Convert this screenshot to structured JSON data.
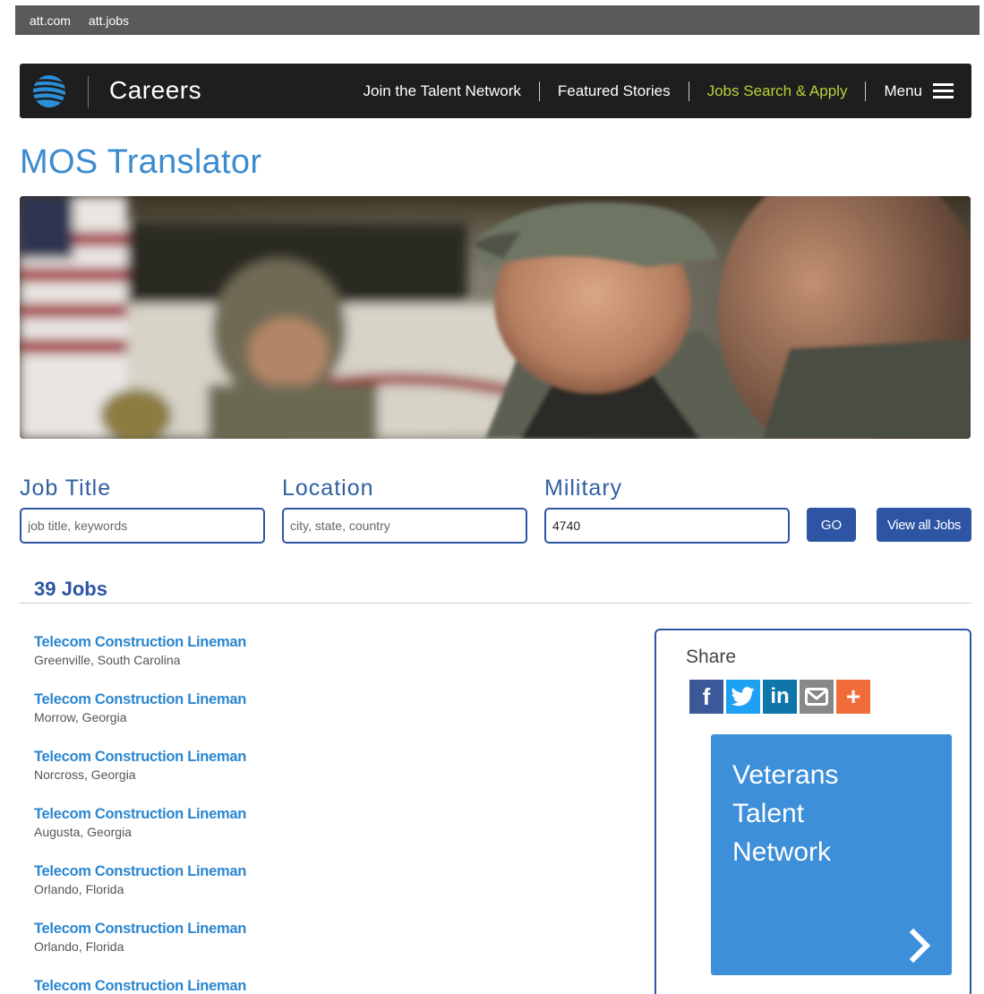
{
  "utility_links": [
    "att.com",
    "att.jobs"
  ],
  "nav": {
    "brand": "Careers",
    "links": [
      "Join the Talent Network",
      "Featured Stories",
      "Jobs Search & Apply"
    ],
    "menu_label": "Menu"
  },
  "page_title": "MOS Translator",
  "search": {
    "job_title_label": "Job Title",
    "job_title_placeholder": "job title, keywords",
    "job_title_value": "",
    "location_label": "Location",
    "location_placeholder": "city, state, country",
    "location_value": "",
    "military_label": "Military",
    "military_value": "4740",
    "go_label": "GO",
    "view_all_label": "View all Jobs"
  },
  "results": {
    "count_text": "39 Jobs",
    "jobs": [
      {
        "title": "Telecom Construction Lineman",
        "location": "Greenville, South Carolina"
      },
      {
        "title": "Telecom Construction Lineman",
        "location": "Morrow, Georgia"
      },
      {
        "title": "Telecom Construction Lineman",
        "location": "Norcross, Georgia"
      },
      {
        "title": "Telecom Construction Lineman",
        "location": "Augusta, Georgia"
      },
      {
        "title": "Telecom Construction Lineman",
        "location": "Orlando, Florida"
      },
      {
        "title": "Telecom Construction Lineman",
        "location": "Orlando, Florida"
      },
      {
        "title": "Telecom Construction Lineman",
        "location": ""
      }
    ]
  },
  "share": {
    "label": "Share",
    "icons": [
      {
        "name": "facebook-icon",
        "glyph": "f",
        "color": "#3b5998"
      },
      {
        "name": "twitter-icon",
        "glyph": "",
        "color": "#1da1f2"
      },
      {
        "name": "linkedin-icon",
        "glyph": "in",
        "color": "#0e76a8"
      },
      {
        "name": "email-icon",
        "glyph": "",
        "color": "#888888"
      },
      {
        "name": "more-share-icon",
        "glyph": "+",
        "color": "#f26b3a"
      }
    ]
  },
  "promo": {
    "line1": "Veterans",
    "line2": "Talent",
    "line3": "Network"
  },
  "colors": {
    "brand_blue": "#2d55a4",
    "link_blue": "#2a86d0",
    "title_blue": "#3b8bd0",
    "active_nav": "#b6d33b",
    "promo_blue": "#3d8fd9"
  }
}
